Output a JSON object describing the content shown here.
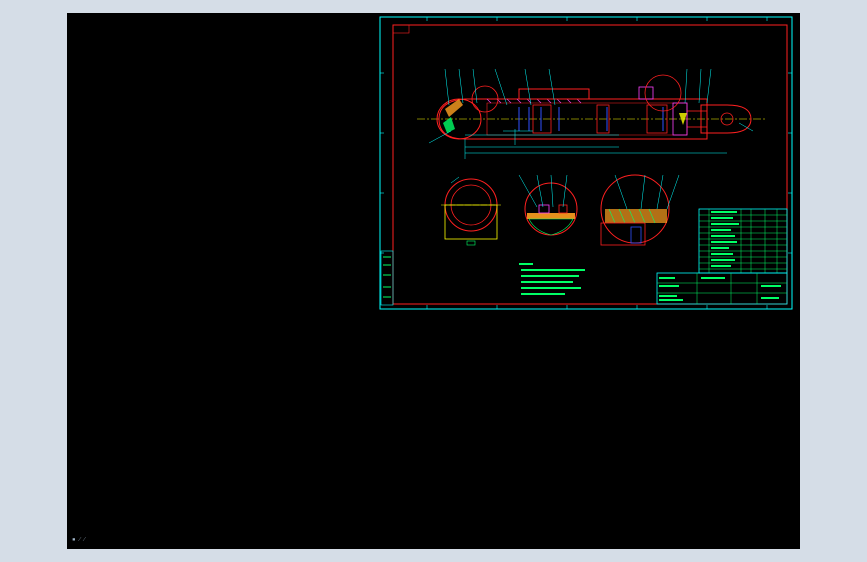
{
  "colors": {
    "outer_background": "#d5dde7",
    "model_space": "#000000",
    "frame_cyan": "#00ffff",
    "frame_red": "#ff2020",
    "part_yellow": "#ffff00",
    "dimension_green": "#00ff66",
    "hidden_blue": "#3050ff",
    "hatch_orange": "#ffa020",
    "part_magenta": "#ff40ff"
  },
  "canvas": {
    "ucs_label": "▪ ⁄ ⁄"
  },
  "icons": [
    "ucs-icon"
  ]
}
